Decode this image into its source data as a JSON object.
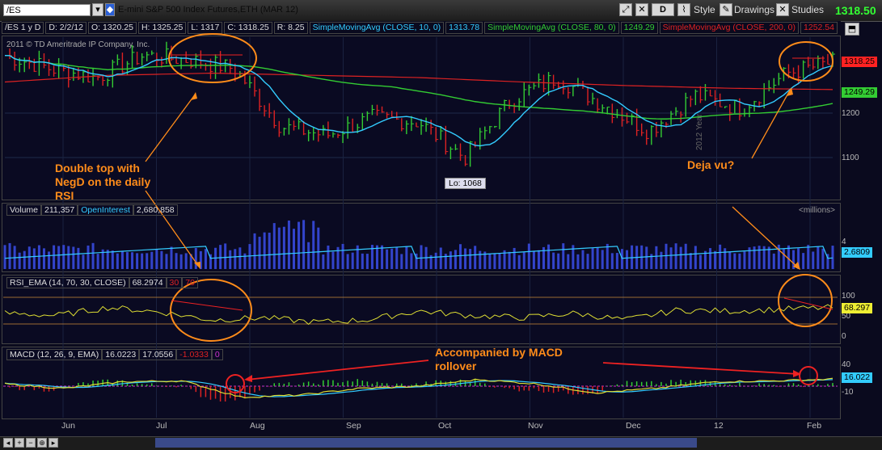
{
  "toolbar": {
    "symbol": "/ES",
    "title": "E-mini S&P 500 Index Futures,ETH (MAR 12)",
    "period_button": "D",
    "style_label": "Style",
    "drawings_label": "Drawings",
    "studies_label": "Studies",
    "last_price": "1318.50"
  },
  "infobar": {
    "label": "/ES 1 y D",
    "date": "D: 2/2/12",
    "open": "O: 1320.25",
    "high": "H: 1325.25",
    "low": "L: 1317",
    "close": "C: 1318.25",
    "range": "R: 8.25",
    "sma10_label": "SimpleMovingAvg (CLOSE, 10, 0)",
    "sma10_value": "1313.78",
    "sma80_label": "SimpleMovingAvg (CLOSE, 80, 0)",
    "sma80_value": "1249.29",
    "sma200_label": "SimpleMovingAvg (CLOSE, 200, 0)",
    "sma200_value": "1252.54"
  },
  "price_pane": {
    "copyright": "2011 © TD Ameritrade IP Company, Inc.",
    "low_label": "Lo: 1068",
    "year_label": "2012 Year",
    "badges": {
      "price": "1318.25",
      "sma80": "1249.29"
    },
    "ticks": [
      "1200",
      "1100"
    ]
  },
  "volume_pane": {
    "label": "Volume",
    "value": "211,357",
    "oi_label": "OpenInterest",
    "oi_value": "2,680,858",
    "units": "<millions>",
    "badge": "2.6809",
    "ticks": [
      "4"
    ]
  },
  "rsi_pane": {
    "label": "RSI_EMA (14, 70, 30, CLOSE)",
    "value": "68.2974",
    "ob": "30",
    "os": "70",
    "badge": "68.297",
    "ticks": [
      "100",
      "50",
      "0"
    ]
  },
  "macd_pane": {
    "label": "MACD (12, 26, 9, EMA)",
    "macd": "16.0223",
    "avg": "17.0556",
    "diff": "-1.0333",
    "zero": "0",
    "badge": "16.022",
    "ticks": [
      "40",
      "-10"
    ]
  },
  "months": [
    "Jun",
    "Jul",
    "Aug",
    "Sep",
    "Oct",
    "Nov",
    "Dec",
    "12",
    "Feb"
  ],
  "annotations": {
    "double_top": "Double top with NegD on the daily RSI",
    "deja_vu": "Deja vu?",
    "macd_note": "Accompanied by MACD rollover"
  },
  "colors": {
    "sma10": "#33ccff",
    "sma80": "#33cc33",
    "sma200": "#dd2222",
    "up_bar": "#33cc33",
    "down_bar": "#dd2222",
    "annotation": "#ff8c1a",
    "volume_bar": "#3344cc"
  },
  "chart_data": {
    "type": "line",
    "x": [
      "Jun",
      "Jul",
      "Aug",
      "Sep",
      "Oct",
      "Nov",
      "Dec",
      "12",
      "Feb"
    ],
    "series": [
      {
        "name": "SimpleMovingAvg (CLOSE, 10, 0)",
        "values": [
          1330,
          1300,
          1290,
          1180,
          1180,
          1230,
          1200,
          1270,
          1314
        ]
      },
      {
        "name": "SimpleMovingAvg (CLOSE, 80, 0)",
        "values": [
          1330,
          1320,
          1310,
          1270,
          1230,
          1210,
          1220,
          1240,
          1249
        ]
      },
      {
        "name": "SimpleMovingAvg (CLOSE, 200, 0)",
        "values": [
          1270,
          1285,
          1290,
          1285,
          1280,
          1270,
          1262,
          1256,
          1253
        ]
      }
    ],
    "low": 1068,
    "rsi_levels": [
      30,
      70
    ],
    "macd_last": 16.0223
  }
}
